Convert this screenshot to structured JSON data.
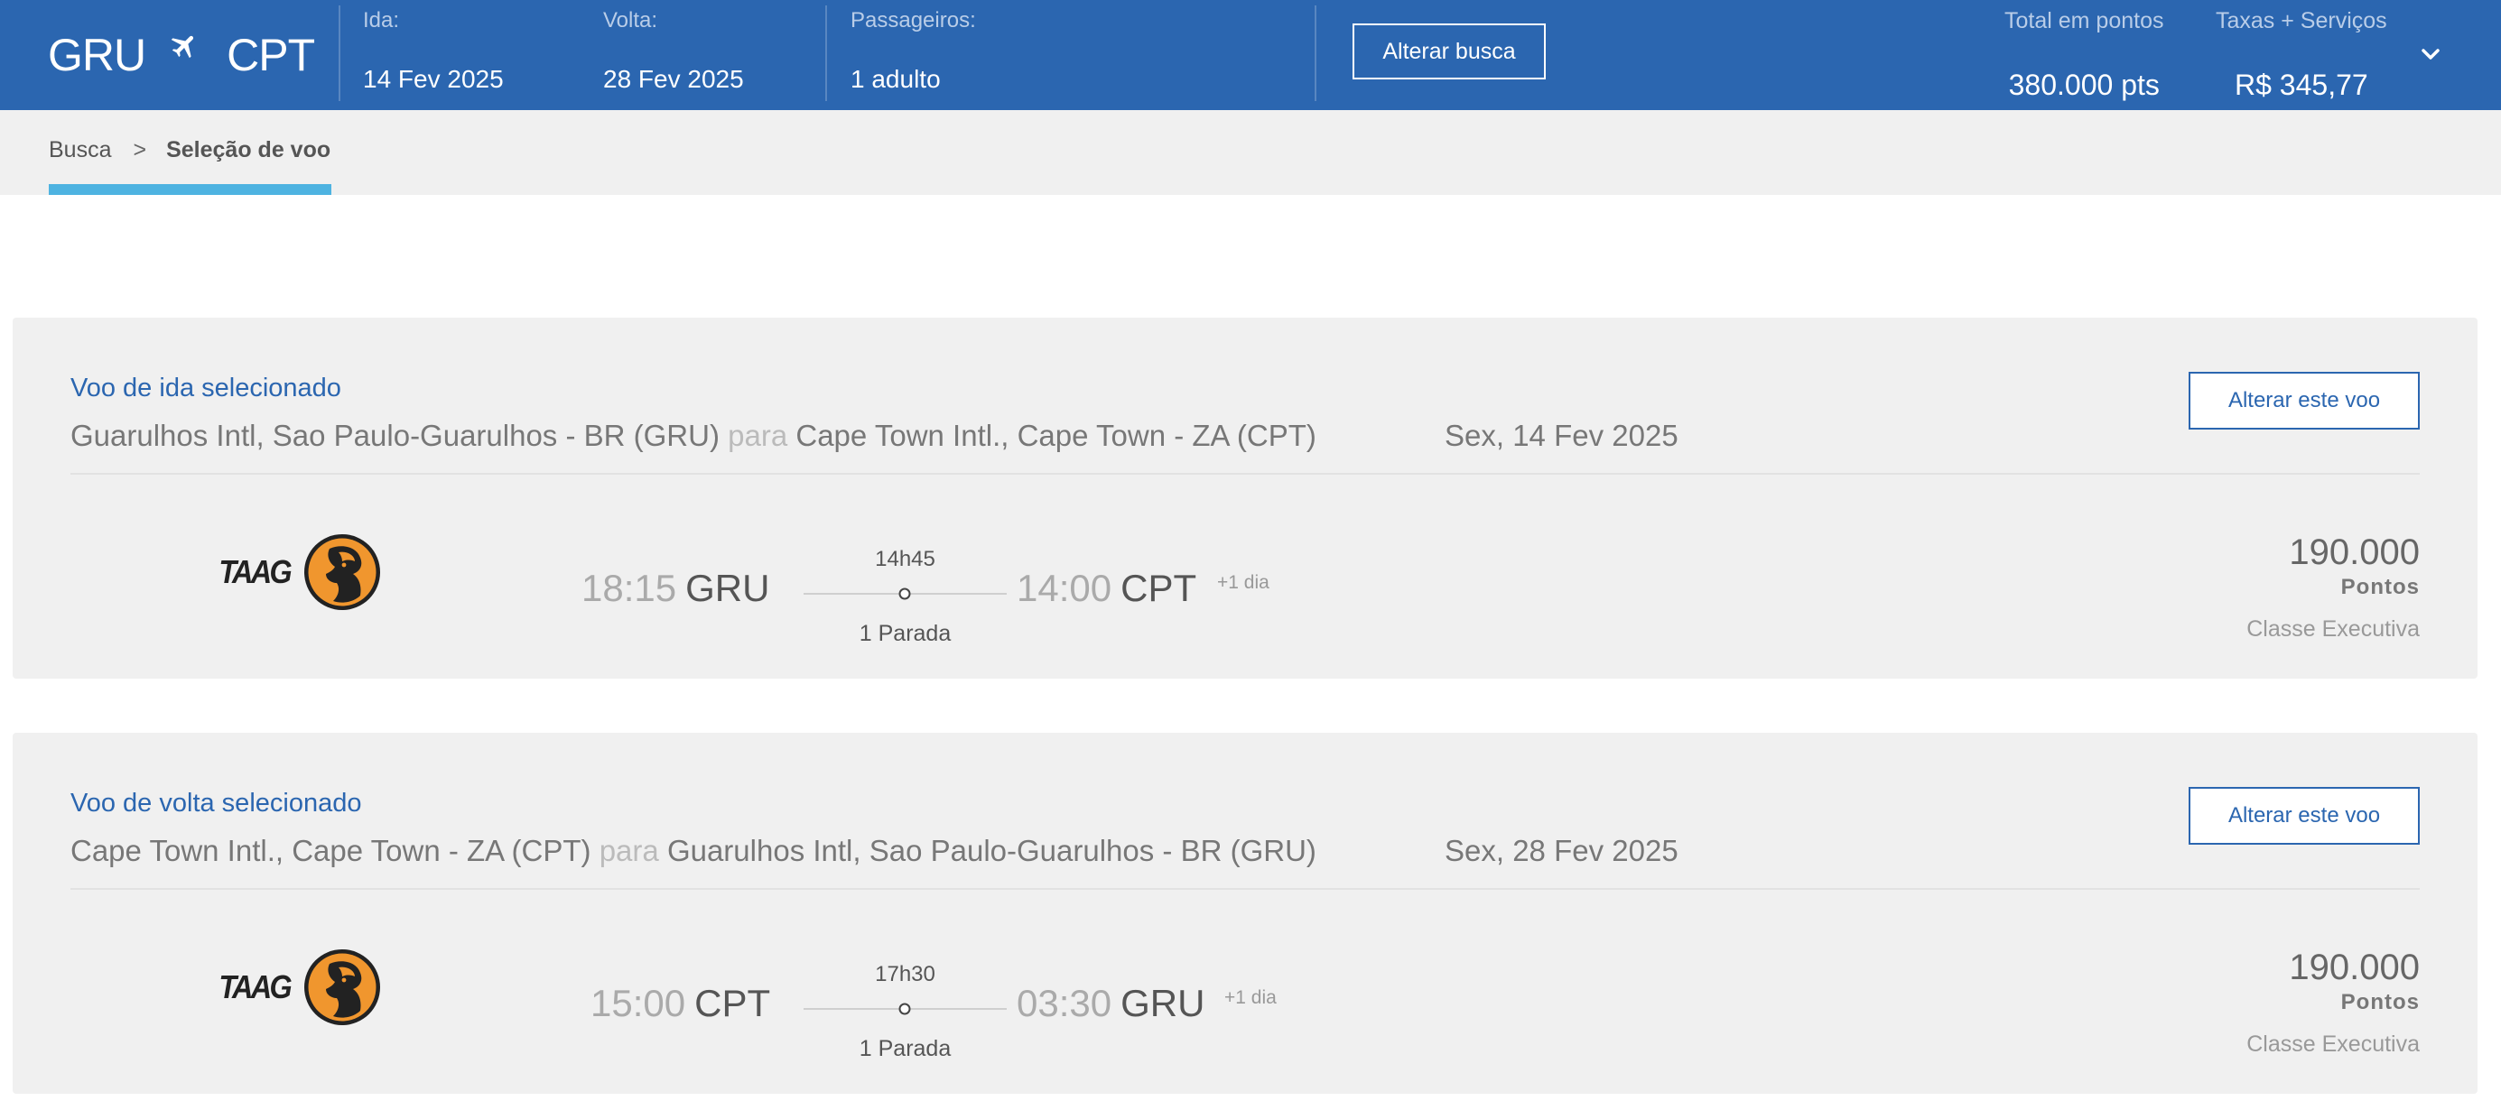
{
  "header": {
    "origin": "GRU",
    "destination": "CPT",
    "ida_label": "Ida:",
    "ida_value": "14 Fev 2025",
    "volta_label": "Volta:",
    "volta_value": "28 Fev 2025",
    "passengers_label": "Passageiros:",
    "passengers_value": "1 adulto",
    "change_search_label": "Alterar busca",
    "total_points_label": "Total em pontos",
    "total_points_value": "380.000 pts",
    "taxes_label": "Taxas + Serviços",
    "taxes_value": "R$ 345,77"
  },
  "breadcrumb": {
    "items": [
      "Busca",
      "Seleção de voo"
    ],
    "separator": ">"
  },
  "colors": {
    "brand_blue": "#2b66b0",
    "accent_cyan": "#4eb3e1",
    "panel_gray": "#f0f0f0",
    "taag_orange": "#f0962e"
  },
  "flights": [
    {
      "title": "Voo de ida selecionado",
      "from": "Guarulhos Intl, Sao Paulo-Guarulhos - BR (GRU)",
      "para": "para",
      "to": "Cape Town Intl., Cape Town - ZA (CPT)",
      "date": "Sex, 14 Fev 2025",
      "change_label": "Alterar este voo",
      "airline_logo_text": "TAAG",
      "airline_icon": "taag-palanca-logo",
      "dep_time": "18:15",
      "dep_code": "GRU",
      "duration": "14h45",
      "stops": "1 Parada",
      "arr_time": "14:00",
      "arr_code": "CPT",
      "plus_day": "+1 dia",
      "points": "190.000",
      "points_unit": "Pontos",
      "cabin": "Classe Executiva"
    },
    {
      "title": "Voo de volta selecionado",
      "from": "Cape Town Intl., Cape Town - ZA (CPT)",
      "para": "para",
      "to": "Guarulhos Intl, Sao Paulo-Guarulhos - BR (GRU)",
      "date": "Sex, 28 Fev 2025",
      "change_label": "Alterar este voo",
      "airline_logo_text": "TAAG",
      "airline_icon": "taag-palanca-logo",
      "dep_time": "15:00",
      "dep_code": "CPT",
      "duration": "17h30",
      "stops": "1 Parada",
      "arr_time": "03:30",
      "arr_code": "GRU",
      "plus_day": "+1 dia",
      "points": "190.000",
      "points_unit": "Pontos",
      "cabin": "Classe Executiva"
    }
  ]
}
